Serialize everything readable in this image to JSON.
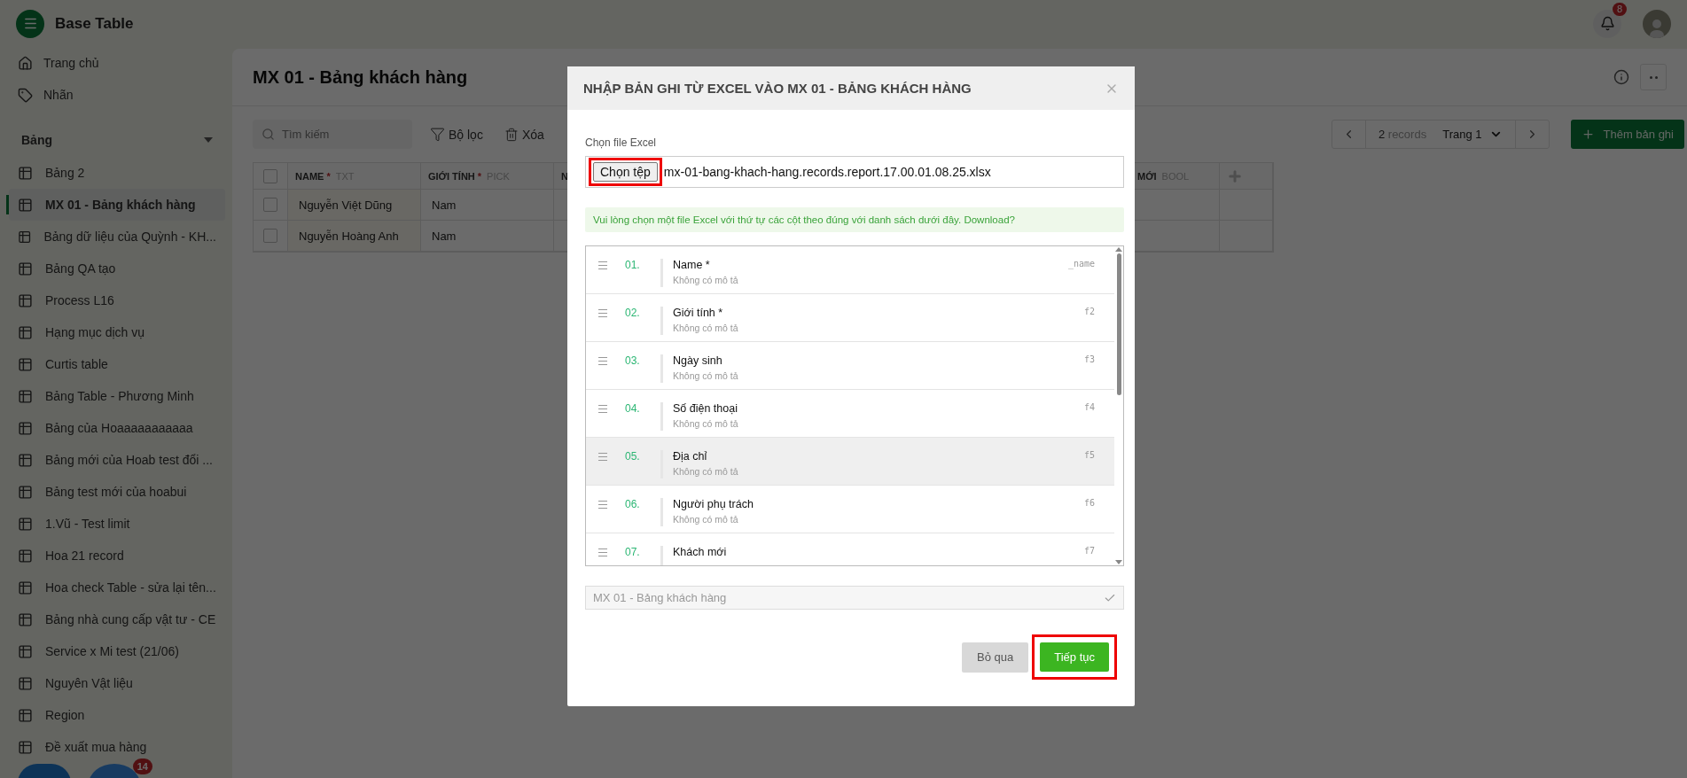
{
  "app": {
    "name": "Base Table",
    "notification_count": "8"
  },
  "sidebar": {
    "nav": [
      {
        "label": "Trang chủ"
      },
      {
        "label": "Nhãn"
      }
    ],
    "section": {
      "label": "Bảng",
      "expanded": true
    },
    "items": [
      {
        "label": "Bảng 2",
        "selected": false
      },
      {
        "label": "MX 01 - Bảng khách hàng",
        "selected": true
      },
      {
        "label": "Bảng dữ liệu của Quỳnh - KH...",
        "selected": false
      },
      {
        "label": "Bảng QA tạo",
        "selected": false
      },
      {
        "label": "Process L16",
        "selected": false
      },
      {
        "label": "Hạng mục dịch vụ",
        "selected": false
      },
      {
        "label": "Curtis table",
        "selected": false
      },
      {
        "label": "Bảng Table - Phương Minh",
        "selected": false
      },
      {
        "label": "Bảng của Hoaaaaaaaaaaa",
        "selected": false
      },
      {
        "label": "Bảng mới của Hoab test đổi ...",
        "selected": false
      },
      {
        "label": "Bảng test mới của hoabui",
        "selected": false
      },
      {
        "label": "1.Vũ - Test limit",
        "selected": false
      },
      {
        "label": "Hoa 21 record",
        "selected": false
      },
      {
        "label": "Hoa check Table - sửa lại tên...",
        "selected": false
      },
      {
        "label": "Bảng nhà cung cấp vật tư - CE",
        "selected": false
      },
      {
        "label": "Service x Mi test (21/06)",
        "selected": false
      },
      {
        "label": "Nguyên Vật liệu",
        "selected": false
      },
      {
        "label": "Region",
        "selected": false
      },
      {
        "label": "Đề xuất mua hàng",
        "selected": false
      }
    ],
    "widget_badge": "14"
  },
  "page": {
    "title": "MX 01 - Bảng khách hàng",
    "search_placeholder": "Tìm kiếm",
    "filter": "Bộ lọc",
    "delete": "Xóa",
    "records_count": "2",
    "records_label": "records",
    "page_select": "Trang 1",
    "add_button": "Thêm bản ghi"
  },
  "table": {
    "all_checked": false,
    "columns": [
      {
        "name": "NAME",
        "mark": "*",
        "type": "TXT"
      },
      {
        "name": "GIỚI TÍNH",
        "mark": "*",
        "type": "PICK"
      },
      {
        "name": "N"
      },
      {
        "name": "MỚI",
        "type": "BOOL"
      }
    ],
    "rows": [
      {
        "checked": false,
        "cells": [
          "Nguyễn Việt Dũng",
          "Nam"
        ]
      },
      {
        "checked": false,
        "cells": [
          "Nguyễn Hoàng Anh",
          "Nam"
        ]
      }
    ]
  },
  "modal": {
    "title": "NHẬP BẢN GHI TỪ EXCEL VÀO MX 01 - BẢNG KHÁCH HÀNG",
    "file_label": "Chọn file Excel",
    "file_button": "Chọn tệp",
    "file_button_annotated": true,
    "file_name": "mx-01-bang-khach-hang.records.report.17.00.01.08.25.xlsx",
    "info": "Vui lòng chọn một file Excel với thứ tự các cột theo đúng với danh sách dưới đây. Download?",
    "fields": [
      {
        "number": "01.",
        "name": "Name *",
        "description": "Không có mô tả",
        "key": "_name",
        "highlighted": false
      },
      {
        "number": "02.",
        "name": "Giới tính *",
        "description": "Không có mô tả",
        "key": "f2",
        "highlighted": false
      },
      {
        "number": "03.",
        "name": "Ngày sinh",
        "description": "Không có mô tả",
        "key": "f3",
        "highlighted": false
      },
      {
        "number": "04.",
        "name": "Số điện thoại",
        "description": "Không có mô tả",
        "key": "f4",
        "highlighted": false
      },
      {
        "number": "05.",
        "name": "Địa chỉ",
        "description": "Không có mô tả",
        "key": "f5",
        "highlighted": true
      },
      {
        "number": "06.",
        "name": "Người phụ trách",
        "description": "Không có mô tả",
        "key": "f6",
        "highlighted": false
      },
      {
        "number": "07.",
        "name": "Khách mới",
        "key": "f7",
        "highlighted": false
      }
    ],
    "target_table": "MX 01 - Bảng khách hàng",
    "buttons": {
      "cancel": "Bỏ qua",
      "confirm": "Tiếp tục",
      "confirm_annotated": true
    }
  }
}
